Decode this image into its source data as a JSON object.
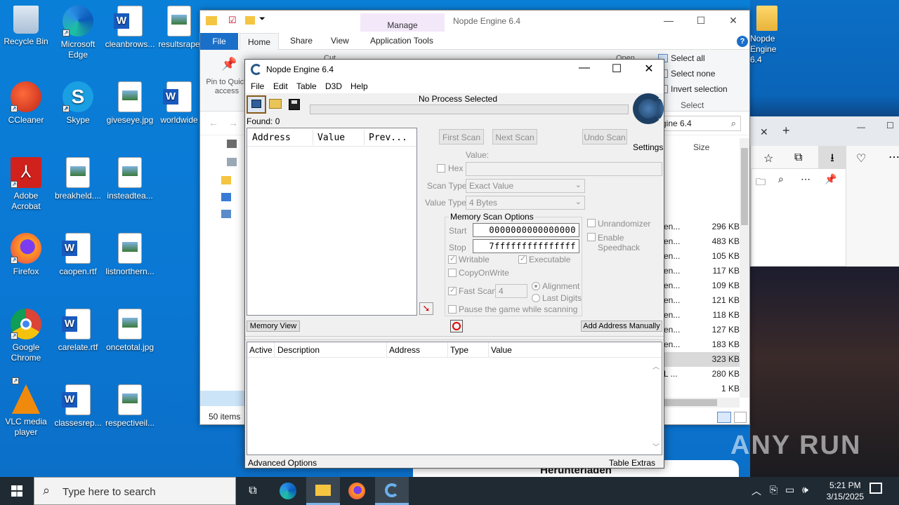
{
  "desktop": {
    "icons": [
      {
        "label": "Recycle Bin"
      },
      {
        "label": "Microsoft Edge"
      },
      {
        "label": "cleanbrows..."
      },
      {
        "label": "resultsrape"
      },
      {
        "label": "CCleaner"
      },
      {
        "label": "Skype"
      },
      {
        "label": "giveseye.jpg"
      },
      {
        "label": "worldwide"
      },
      {
        "label": "Adobe Acrobat"
      },
      {
        "label": "breakheld...."
      },
      {
        "label": "insteadtea..."
      },
      {
        "label": "Firefox"
      },
      {
        "label": "caopen.rtf"
      },
      {
        "label": "listnorthern..."
      },
      {
        "label": "Google Chrome"
      },
      {
        "label": "carelate.rtf"
      },
      {
        "label": "oncetotal.jpg"
      },
      {
        "label": "VLC media player"
      },
      {
        "label": "classesrep..."
      },
      {
        "label": "respectiveil..."
      },
      {
        "label": "Nopde Engine 6.4"
      }
    ]
  },
  "explorer": {
    "title": "Nopde Engine 6.4",
    "manage_tab": "Manage",
    "tabs": {
      "file": "File",
      "home": "Home",
      "share": "Share",
      "view": "View",
      "app_tools": "Application Tools"
    },
    "ribbon": {
      "pin_label": "Pin to Quick access",
      "cut": "Cut",
      "open": "Open",
      "select_all": "Select all",
      "select_none": "Select none",
      "invert_selection": "Invert selection",
      "select_group": "Select"
    },
    "search_value": "gine 6.4",
    "size_header": "Size",
    "sizes": [
      "296 KB",
      "483 KB",
      "105 KB",
      "117 KB",
      "109 KB",
      "121 KB",
      "118 KB",
      "127 KB",
      "183 KB",
      "323 KB",
      "280 KB",
      "1 KB"
    ],
    "type_fragments": [
      "en...",
      "en...",
      "en...",
      "en...",
      "en...",
      "en...",
      "en...",
      "en...",
      "en...",
      "",
      "L ...",
      ""
    ],
    "status": "50 items"
  },
  "edge": {
    "download_banner": "Herunterladen"
  },
  "ce": {
    "title": "Nopde Engine 6.4",
    "menu": [
      "File",
      "Edit",
      "Table",
      "D3D",
      "Help"
    ],
    "process": "No Process Selected",
    "found": "Found: 0",
    "list_headers": [
      "Address",
      "Value",
      "Prev..."
    ],
    "first_scan": "First Scan",
    "next_scan": "Next Scan",
    "undo_scan": "Undo Scan",
    "settings": "Settings",
    "value_label": "Value:",
    "hex": "Hex",
    "scan_type_label": "Scan Type",
    "scan_type": "Exact Value",
    "value_type_label": "Value Type",
    "value_type": "4 Bytes",
    "mem_opts": "Memory Scan Options",
    "start_label": "Start",
    "start": "0000000000000000",
    "stop_label": "Stop",
    "stop": "7fffffffffffffff",
    "writable": "Writable",
    "executable": "Executable",
    "copyonwrite": "CopyOnWrite",
    "fast_scan": "Fast Scan",
    "fast_scan_value": "4",
    "alignment": "Alignment",
    "last_digits": "Last Digits",
    "pause": "Pause the game while scanning",
    "unrandomizer": "Unrandomizer",
    "speedhack": "Enable Speedhack",
    "memory_view": "Memory View",
    "add_address": "Add Address Manually",
    "table_headers": [
      "Active",
      "Description",
      "Address",
      "Type",
      "Value"
    ],
    "advanced": "Advanced Options",
    "table_extras": "Table Extras"
  },
  "taskbar": {
    "search_placeholder": "Type here to search",
    "time": "5:21 PM",
    "date": "3/15/2025"
  },
  "watermark": "ANY RUN"
}
